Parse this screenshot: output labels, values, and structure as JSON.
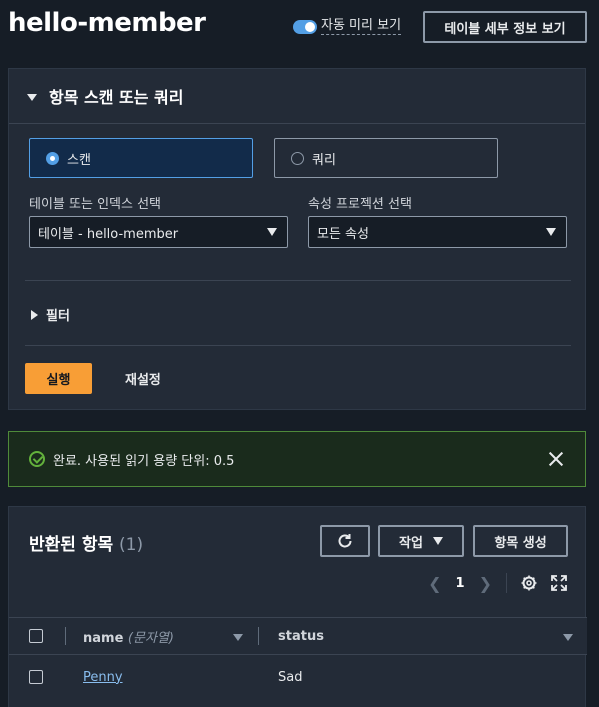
{
  "page": {
    "title": "hello-member",
    "preview_toggle_label": "자동 미리 보기",
    "preview_toggle_on": true,
    "details_button": "테이블 세부 정보 보기"
  },
  "scan_panel": {
    "title": "항목 스캔 또는 쿼리",
    "options": [
      {
        "label": "스캔",
        "selected": true
      },
      {
        "label": "쿼리",
        "selected": false
      }
    ],
    "table_select_label": "테이블 또는 인덱스 선택",
    "table_select_value": "테이블 - hello-member",
    "projection_label": "속성 프로젝션 선택",
    "projection_value": "모든 속성",
    "filter_label": "필터",
    "run_button": "실행",
    "reset_button": "재설정"
  },
  "alert": {
    "text": "완료. 사용된 읽기 용량 단위: 0.5",
    "type": "success"
  },
  "results": {
    "title": "반환된 항목",
    "count": "(1)",
    "actions_button": "작업",
    "create_button": "항목 생성",
    "page": "1",
    "columns": [
      {
        "label": "name",
        "type_hint": "(문자열)"
      },
      {
        "label": "status",
        "type_hint": ""
      }
    ],
    "rows": [
      {
        "name": "Penny",
        "status": "Sad"
      }
    ]
  },
  "colors": {
    "accent": "#539fe5",
    "primary_button": "#f89e36",
    "success": "#63b13c",
    "link": "#89bdee"
  }
}
